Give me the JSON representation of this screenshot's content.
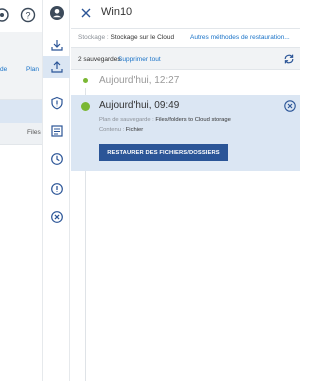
{
  "background": {
    "top_icons": [
      "settings-icon",
      "help-icon",
      "account-icon"
    ],
    "columns": [
      "de",
      "Plan"
    ],
    "row_label": "Files"
  },
  "tool_strip": {
    "items": [
      {
        "icon": "backup-download-icon",
        "active": false
      },
      {
        "icon": "recover-upload-icon",
        "active": true
      },
      {
        "icon": "shield-icon",
        "active": false
      },
      {
        "icon": "list-icon",
        "active": false
      },
      {
        "icon": "clock-icon",
        "active": false
      },
      {
        "icon": "alert-icon",
        "active": false
      },
      {
        "icon": "cancel-icon",
        "active": false
      }
    ]
  },
  "panel": {
    "title": "Win10",
    "storage_label": "Stockage : ",
    "storage_value": "Stockage sur le Cloud",
    "other_methods": "Autres méthodes de restauration...",
    "backups_count": "2 sauvegardes",
    "delete_all": "Supprimer tout",
    "entries": [
      {
        "title": "Aujourd'hui, 12:27"
      },
      {
        "title": "Aujourd'hui, 09:49",
        "plan_label": "Plan de sauvegarde : ",
        "plan_value": "Files/folders to Cloud storage",
        "content_label": "Contenu : ",
        "content_value": "Fichier",
        "restore_label": "RESTAURER DES FICHIERS/DOSSIERS"
      }
    ]
  },
  "colors": {
    "accent": "#1a73c8",
    "button": "#2b5597",
    "selected": "#dbe6f3",
    "status_ok": "#7ab733"
  }
}
